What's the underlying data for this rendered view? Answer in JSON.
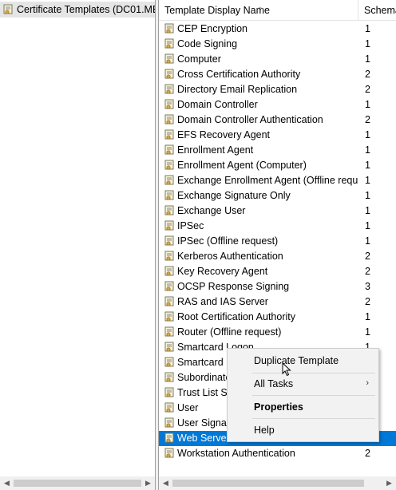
{
  "tree": {
    "selected_node": "Certificate Templates (DC01.MEI"
  },
  "list": {
    "columns": [
      "Template Display Name",
      "Schema"
    ],
    "rows": [
      {
        "name": "CEP Encryption",
        "schema": "1"
      },
      {
        "name": "Code Signing",
        "schema": "1"
      },
      {
        "name": "Computer",
        "schema": "1"
      },
      {
        "name": "Cross Certification Authority",
        "schema": "2"
      },
      {
        "name": "Directory Email Replication",
        "schema": "2"
      },
      {
        "name": "Domain Controller",
        "schema": "1"
      },
      {
        "name": "Domain Controller Authentication",
        "schema": "2"
      },
      {
        "name": "EFS Recovery Agent",
        "schema": "1"
      },
      {
        "name": "Enrollment Agent",
        "schema": "1"
      },
      {
        "name": "Enrollment Agent (Computer)",
        "schema": "1"
      },
      {
        "name": "Exchange Enrollment Agent (Offline requ...",
        "schema": "1"
      },
      {
        "name": "Exchange Signature Only",
        "schema": "1"
      },
      {
        "name": "Exchange User",
        "schema": "1"
      },
      {
        "name": "IPSec",
        "schema": "1"
      },
      {
        "name": "IPSec (Offline request)",
        "schema": "1"
      },
      {
        "name": "Kerberos Authentication",
        "schema": "2"
      },
      {
        "name": "Key Recovery Agent",
        "schema": "2"
      },
      {
        "name": "OCSP Response Signing",
        "schema": "3"
      },
      {
        "name": "RAS and IAS Server",
        "schema": "2"
      },
      {
        "name": "Root Certification Authority",
        "schema": "1"
      },
      {
        "name": "Router (Offline request)",
        "schema": "1"
      },
      {
        "name": "Smartcard Logon",
        "schema": "1"
      },
      {
        "name": "Smartcard U",
        "schema": ""
      },
      {
        "name": "Subordinate",
        "schema": ""
      },
      {
        "name": "Trust List Sig",
        "schema": ""
      },
      {
        "name": "User",
        "schema": ""
      },
      {
        "name": "User Signatu",
        "schema": ""
      },
      {
        "name": "Web Server",
        "schema": "",
        "selected": true
      },
      {
        "name": "Workstation Authentication",
        "schema": "2"
      }
    ]
  },
  "context_menu": {
    "duplicate_template": "Duplicate Template",
    "all_tasks": "All Tasks",
    "properties": "Properties",
    "help": "Help"
  },
  "colors": {
    "selection": "#0078d7",
    "menu_bg": "#f2f2f2"
  },
  "icons": {
    "row": "certificate-template-icon",
    "tree": "certificate-templates-folder-icon"
  }
}
